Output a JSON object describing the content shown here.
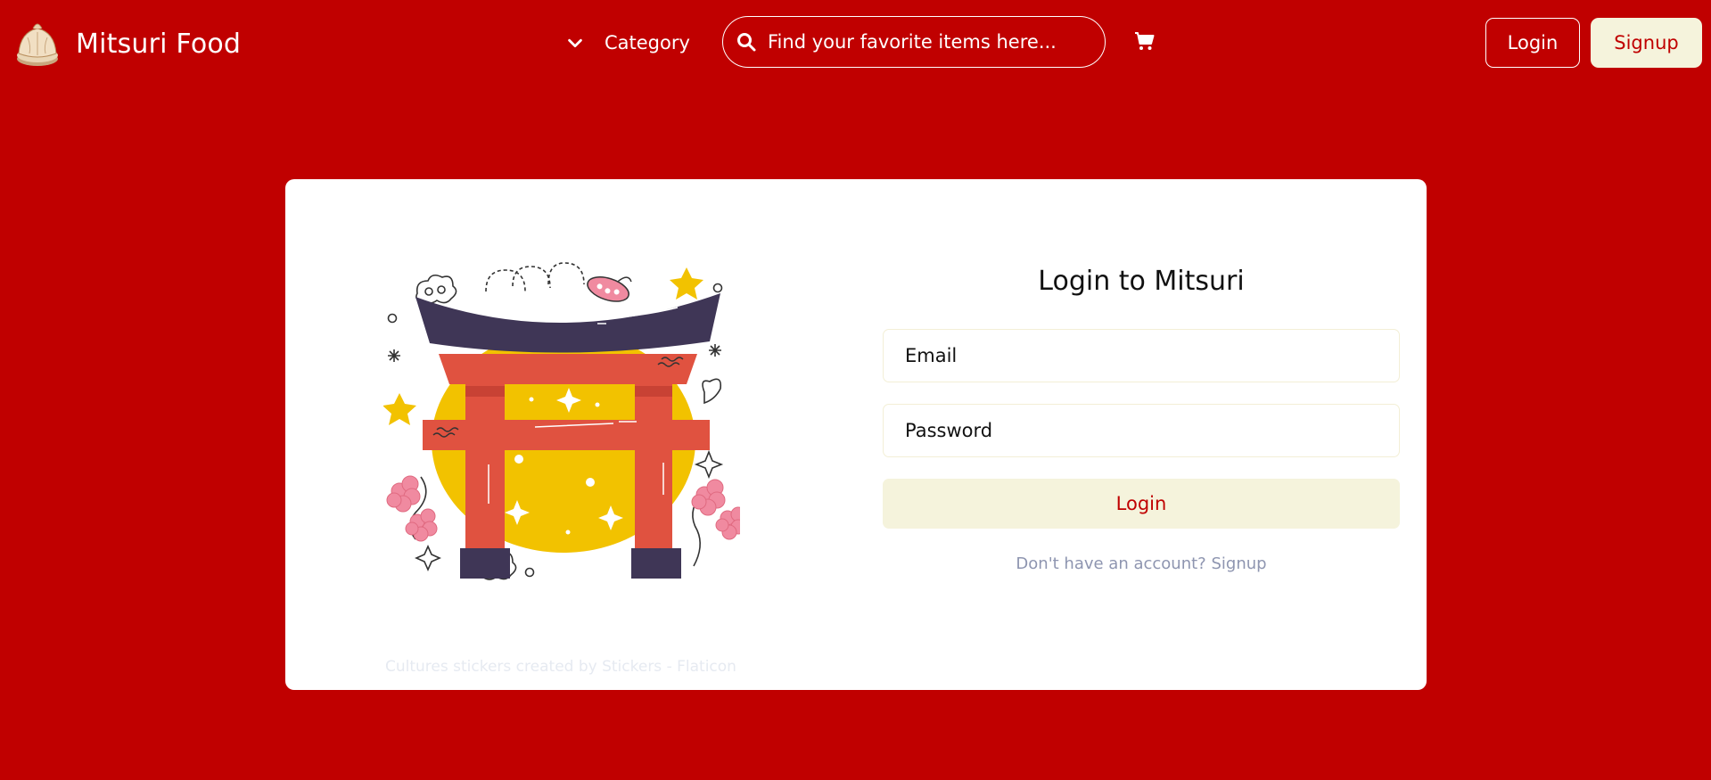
{
  "nav": {
    "brand": "Mitsuri Food",
    "brand_icon": "dumpling-logo-icon",
    "category_label": "Category",
    "category_icon": "chevron-down-icon",
    "search_placeholder": "Find your favorite items here...",
    "search_icon": "search-icon",
    "cart_icon": "cart-icon",
    "login_label": "Login",
    "signup_label": "Signup"
  },
  "login": {
    "title": "Login to Mitsuri",
    "email_placeholder": "Email",
    "password_placeholder": "Password",
    "submit_label": "Login",
    "switch_prefix": "Don't have an account?",
    "switch_link": "Signup"
  },
  "illustration": {
    "icon": "torii-gate-illustration",
    "credit": "Cultures stickers created by Stickers - Flaticon"
  },
  "colors": {
    "background": "#C00000",
    "accent_light": "#F5F3DC",
    "card": "#FFFFFF"
  }
}
